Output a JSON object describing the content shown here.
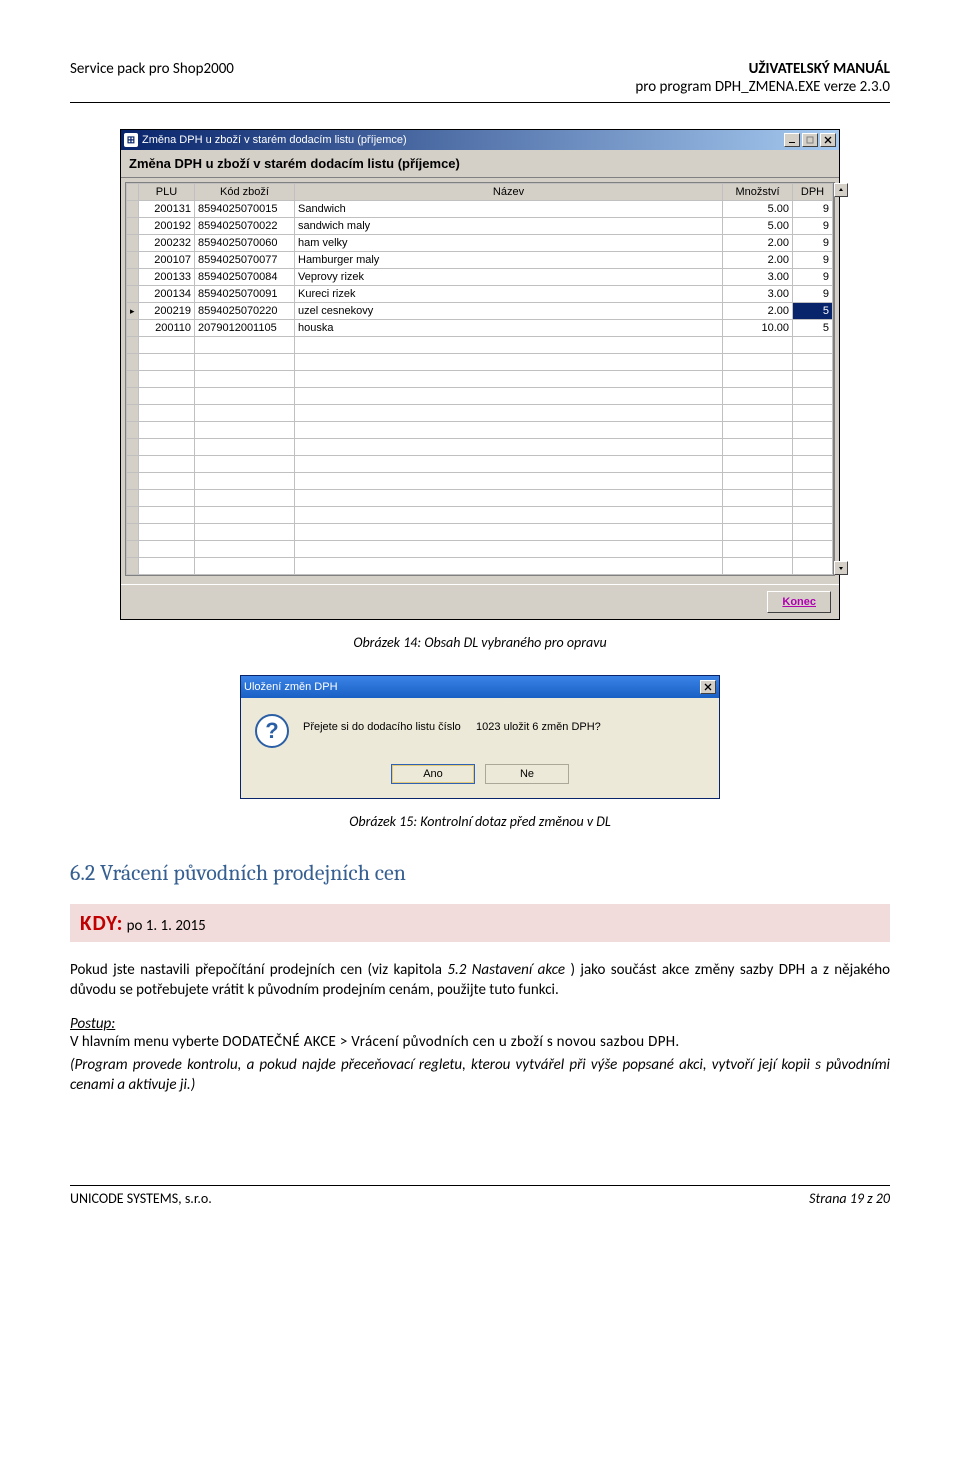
{
  "header": {
    "left": "Service pack pro Shop2000",
    "right_bold": "UŽIVATELSKÝ MANUÁL",
    "right_line2": "pro program DPH_ZMENA.EXE verze 2.3.0"
  },
  "appwin": {
    "title": "Změna DPH u zboží v starém dodacím listu (příjemce)",
    "panel_title": "Změna DPH u zboží v starém dodacím listu (příjemce)",
    "cols": {
      "plu": "PLU",
      "kod": "Kód zboží",
      "nazev": "Název",
      "mn": "Množství",
      "dph": "DPH"
    },
    "rows": [
      {
        "plu": "200131",
        "kod": "8594025070015",
        "nazev": "Sandwich",
        "mn": "5.00",
        "dph": "9",
        "sel": false
      },
      {
        "plu": "200192",
        "kod": "8594025070022",
        "nazev": "sandwich maly",
        "mn": "5.00",
        "dph": "9",
        "sel": false
      },
      {
        "plu": "200232",
        "kod": "8594025070060",
        "nazev": "ham velky",
        "mn": "2.00",
        "dph": "9",
        "sel": false
      },
      {
        "plu": "200107",
        "kod": "8594025070077",
        "nazev": "Hamburger maly",
        "mn": "2.00",
        "dph": "9",
        "sel": false
      },
      {
        "plu": "200133",
        "kod": "8594025070084",
        "nazev": "Veprovy rizek",
        "mn": "3.00",
        "dph": "9",
        "sel": false
      },
      {
        "plu": "200134",
        "kod": "8594025070091",
        "nazev": "Kureci rizek",
        "mn": "3.00",
        "dph": "9",
        "sel": false
      },
      {
        "plu": "200219",
        "kod": "8594025070220",
        "nazev": "uzel cesnekovy",
        "mn": "2.00",
        "dph": "5",
        "sel": true
      },
      {
        "plu": "200110",
        "kod": "2079012001105",
        "nazev": "houska",
        "mn": "10.00",
        "dph": "5",
        "sel": false
      }
    ],
    "empty_rows": 14,
    "konec": "Konec"
  },
  "caption1": "Obrázek 14: Obsah DL vybraného pro opravu",
  "dialog": {
    "title": "Uložení změn DPH",
    "msg_a": "Přejete si do dodacího listu číslo",
    "msg_b": "1023 uložit 6 změn DPH?",
    "btn_yes": "Ano",
    "btn_no": "Ne"
  },
  "caption2": "Obrázek 15: Kontrolní dotaz před změnou v DL",
  "section": {
    "heading": "6.2 Vrácení původních prodejních cen",
    "kdy_label": "KDY:",
    "kdy_value": "po 1. 1. 2015",
    "para1a": "Pokud jste nastavili přepočítání prodejních cen (viz kapitola ",
    "para1b": "5.2 Nastavení akce",
    "para1c": " ) jako součást akce změny sazby DPH a z nějakého důvodu se potřebujete vrátit k původním prodejním cenám, použijte tuto funkci.",
    "postup_label": "Postup:",
    "menu_line_a": "V hlavním menu vyberte ",
    "menu_line_b": "DODATEČNÉ AKCE > Vrácení původních cen u zboží s novou sazbou DPH.",
    "para2": "(Program provede kontrolu, a pokud najde přeceňovací regletu, kterou vytvářel při výše popsané akci, vytvoří její kopii s původními cenami a aktivuje ji.)"
  },
  "footer": {
    "left": "UNICODE SYSTEMS, s.r.o.",
    "right": "Strana 19 z 20"
  }
}
